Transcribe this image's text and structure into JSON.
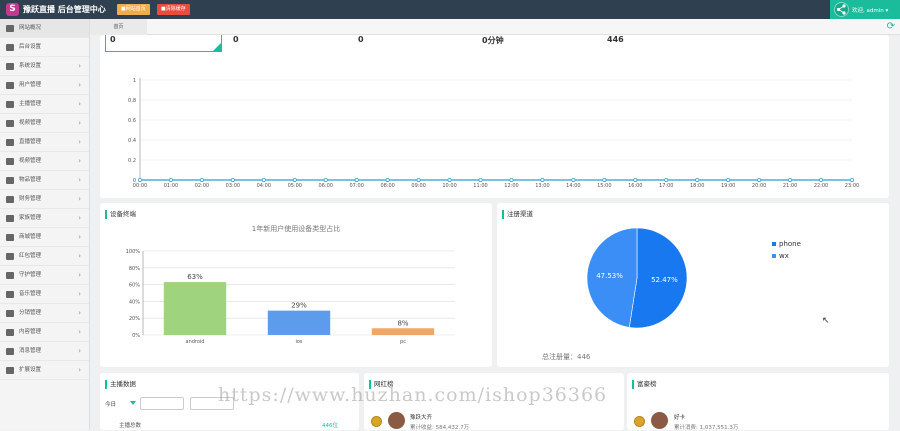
{
  "header": {
    "app_title": "豫跃直播 后台管理中心",
    "logo_letter": "S",
    "btn_front": "■网站首页",
    "btn_clear": "■清除缓存",
    "user": "欢迎, admin ▾"
  },
  "tabs": {
    "home": "首页"
  },
  "sidebar": {
    "items": [
      {
        "label": "网站概况",
        "icon": "chart-icon",
        "chevron": ""
      },
      {
        "label": "后台设置",
        "icon": "monitor-icon",
        "chevron": ""
      },
      {
        "label": "系统设置",
        "icon": "gears-icon",
        "chevron": "›"
      },
      {
        "label": "用户管理",
        "icon": "users-icon",
        "chevron": "›"
      },
      {
        "label": "主播管理",
        "icon": "person-icon",
        "chevron": "›"
      },
      {
        "label": "视频管理",
        "icon": "monitor-icon",
        "chevron": "›"
      },
      {
        "label": "直播管理",
        "icon": "monitor-icon",
        "chevron": "›"
      },
      {
        "label": "视频管理",
        "icon": "video-icon",
        "chevron": "›"
      },
      {
        "label": "物品管理",
        "icon": "video-icon",
        "chevron": "›"
      },
      {
        "label": "财务管理",
        "icon": "yen-icon",
        "chevron": "›"
      },
      {
        "label": "家族管理",
        "icon": "bank-icon",
        "chevron": "›"
      },
      {
        "label": "商城管理",
        "icon": "cart-icon",
        "chevron": "›"
      },
      {
        "label": "红包管理",
        "icon": "envelope-icon",
        "chevron": "›"
      },
      {
        "label": "守护管理",
        "icon": "shield-icon",
        "chevron": "›"
      },
      {
        "label": "音乐管理",
        "icon": "music-icon",
        "chevron": "›"
      },
      {
        "label": "分销管理",
        "icon": "sitemap-icon",
        "chevron": "›"
      },
      {
        "label": "内容管理",
        "icon": "grid-icon",
        "chevron": "›"
      },
      {
        "label": "消息管理",
        "icon": "bell-icon",
        "chevron": "›"
      },
      {
        "label": "扩展设置",
        "icon": "cloud-icon",
        "chevron": "›"
      }
    ]
  },
  "stats": {
    "v1": "0",
    "v2": "0",
    "v3": "0",
    "v4": "0分钟",
    "v5": "446"
  },
  "chart_data": [
    {
      "type": "line",
      "title": "",
      "x": [
        "00:00",
        "01:00",
        "02:00",
        "03:00",
        "04:00",
        "05:00",
        "06:00",
        "07:00",
        "08:00",
        "09:00",
        "10:00",
        "11:00",
        "12:00",
        "13:00",
        "14:00",
        "15:00",
        "16:00",
        "17:00",
        "18:00",
        "19:00",
        "20:00",
        "21:00",
        "22:00",
        "23:00"
      ],
      "series": [
        {
          "values": [
            0,
            0,
            0,
            0,
            0,
            0,
            0,
            0,
            0,
            0,
            0,
            0,
            0,
            0,
            0,
            0,
            0,
            0,
            0,
            0,
            0,
            0,
            0,
            0
          ]
        }
      ],
      "ylim": [
        0,
        1
      ],
      "yticks": [
        "0",
        "0.2",
        "0.4",
        "0.6",
        "0.8",
        "1"
      ],
      "grid": true,
      "color": "#2a9dc9"
    },
    {
      "type": "bar",
      "title": "设备终端",
      "subtitle": "1年新用户使用设备类型占比",
      "categories": [
        "android",
        "ios",
        "pc"
      ],
      "values": [
        63,
        29,
        8
      ],
      "labels": [
        "63%",
        "29%",
        "8%"
      ],
      "colors": [
        "#9fd37d",
        "#5d9cec",
        "#f0a765"
      ],
      "ylim": [
        0,
        100
      ],
      "yticks": [
        "0%",
        "20%",
        "40%",
        "60%",
        "80%",
        "100%"
      ],
      "grid": true
    },
    {
      "type": "pie",
      "title": "注册渠道",
      "categories": [
        "phone",
        "wx"
      ],
      "values": [
        52.47,
        47.53
      ],
      "labels": [
        "52.47%",
        "47.53%"
      ],
      "colors": [
        "#1878f0",
        "#3a8ef5"
      ],
      "legend": "top-right"
    }
  ],
  "follow_total": "总注册量：446",
  "anchor": {
    "title": "主播数据",
    "filter_label": "今日",
    "col_label": "主播总数",
    "total": "446位"
  },
  "wanghong": {
    "title": "网红榜",
    "name": "豫跃大齐",
    "stat": "累计收益: 584,432.7万"
  },
  "haoyou": {
    "title": "富豪榜",
    "name": "好卡",
    "stat": "累计消费: 1,037,551.3万"
  },
  "watermark": "https://www.huzhan.com/ishop36366",
  "colors": {
    "accent": "#1abc9c",
    "topbar": "#2f4050",
    "line": "#2a9dc9"
  }
}
